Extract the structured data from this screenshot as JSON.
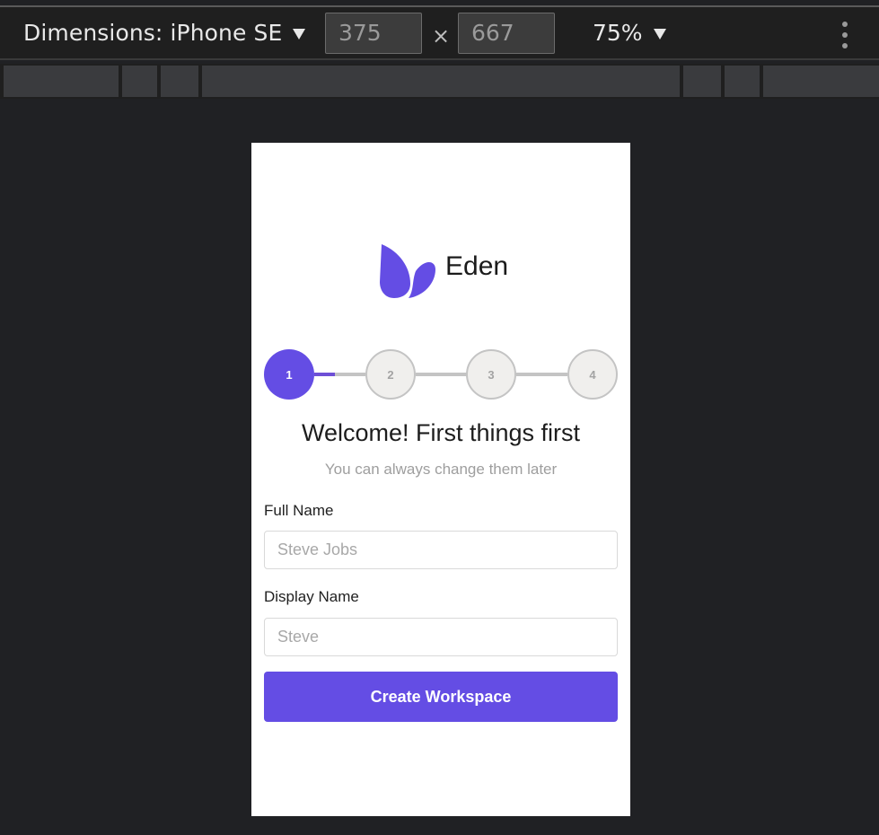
{
  "devtools": {
    "dimensions_label": "Dimensions: iPhone SE",
    "width_value": "375",
    "height_value": "667",
    "times_symbol": "×",
    "zoom_label": "75%"
  },
  "app": {
    "brand": "Eden",
    "accent_color": "#644de4",
    "steps": [
      "1",
      "2",
      "3",
      "4"
    ],
    "active_step": 1,
    "heading": "Welcome! First things first",
    "subheading": "You can always change them later",
    "form": {
      "full_name_label": "Full Name",
      "full_name_placeholder": "Steve Jobs",
      "display_name_label": "Display Name",
      "display_name_placeholder": "Steve",
      "submit_label": "Create Workspace"
    }
  }
}
